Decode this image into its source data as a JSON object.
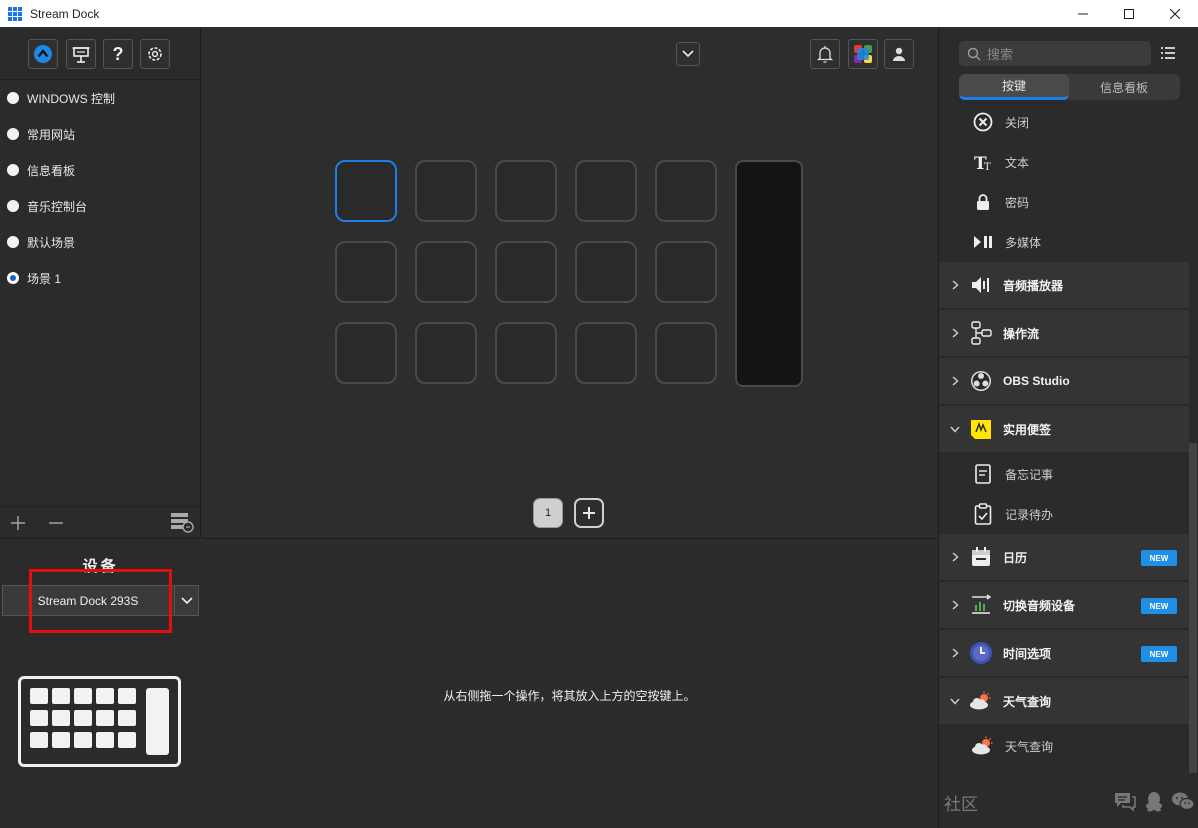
{
  "window": {
    "title": "Stream Dock",
    "minimize_icon": "minimize-icon",
    "maximize_icon": "maximize-icon",
    "close_icon": "close-icon"
  },
  "left_toolbar": {
    "icons": [
      "store-icon",
      "presentation-icon",
      "help-icon",
      "gear-icon"
    ],
    "help_label": "?"
  },
  "profiles": [
    {
      "label": "WINDOWS 控制",
      "selected": false
    },
    {
      "label": "常用网站",
      "selected": false
    },
    {
      "label": "信息看板",
      "selected": false
    },
    {
      "label": "音乐控制台",
      "selected": false
    },
    {
      "label": "默认场景",
      "selected": false
    },
    {
      "label": "场景 1",
      "selected": true
    }
  ],
  "profile_tools": {
    "add_icon": "plus-icon",
    "remove_icon": "minus-icon",
    "manage_icon": "profile-manager-icon"
  },
  "device": {
    "label": "设备",
    "selected": "Stream Dock 293S",
    "highlight_color": "#e01010"
  },
  "canvas": {
    "top_icons": [
      "chevron-down-icon",
      "bell-icon",
      "plugin-store-icon",
      "user-icon"
    ],
    "selected_key_color": "#1e7ee8",
    "page_number": "1",
    "add_page_label": "+",
    "hint": "从右侧拖一个操作，将其放入上方的空按键上。"
  },
  "actions_panel": {
    "search_placeholder": "搜索",
    "tabs": [
      {
        "label": "按键",
        "active": true
      },
      {
        "label": "信息看板",
        "active": false
      }
    ],
    "items": [
      {
        "kind": "sub",
        "label": "关闭",
        "icon": "close-circle-icon"
      },
      {
        "kind": "sub",
        "label": "文本",
        "icon": "text-icon"
      },
      {
        "kind": "sub",
        "label": "密码",
        "icon": "lock-icon"
      },
      {
        "kind": "sub",
        "label": "多媒体",
        "icon": "play-pause-icon"
      },
      {
        "kind": "cat",
        "label": "音频播放器",
        "icon": "speaker-icon",
        "expanded": false,
        "badge": ""
      },
      {
        "kind": "cat",
        "label": "操作流",
        "icon": "workflow-icon",
        "expanded": false,
        "badge": ""
      },
      {
        "kind": "cat",
        "label": "OBS Studio",
        "icon": "obs-icon",
        "expanded": false,
        "badge": ""
      },
      {
        "kind": "cat",
        "label": "实用便签",
        "icon": "sticky-note-icon",
        "expanded": true,
        "badge": ""
      },
      {
        "kind": "sub",
        "label": "备忘记事",
        "icon": "memo-icon"
      },
      {
        "kind": "sub",
        "label": "记录待办",
        "icon": "clipboard-check-icon"
      },
      {
        "kind": "cat",
        "label": "日历",
        "icon": "calendar-icon",
        "expanded": false,
        "badge": "NEW"
      },
      {
        "kind": "cat",
        "label": "切换音频设备",
        "icon": "audio-switch-icon",
        "expanded": false,
        "badge": "NEW"
      },
      {
        "kind": "cat",
        "label": "时间选项",
        "icon": "clock-icon",
        "expanded": false,
        "badge": "NEW"
      },
      {
        "kind": "cat",
        "label": "天气查询",
        "icon": "weather-icon",
        "expanded": true,
        "badge": ""
      },
      {
        "kind": "sub",
        "label": "天气查询",
        "icon": "weather-icon"
      }
    ],
    "badge_color": "#1e90e8",
    "community": {
      "label": "社区",
      "icons": [
        "chat-icon",
        "qq-icon",
        "wechat-icon"
      ]
    }
  }
}
